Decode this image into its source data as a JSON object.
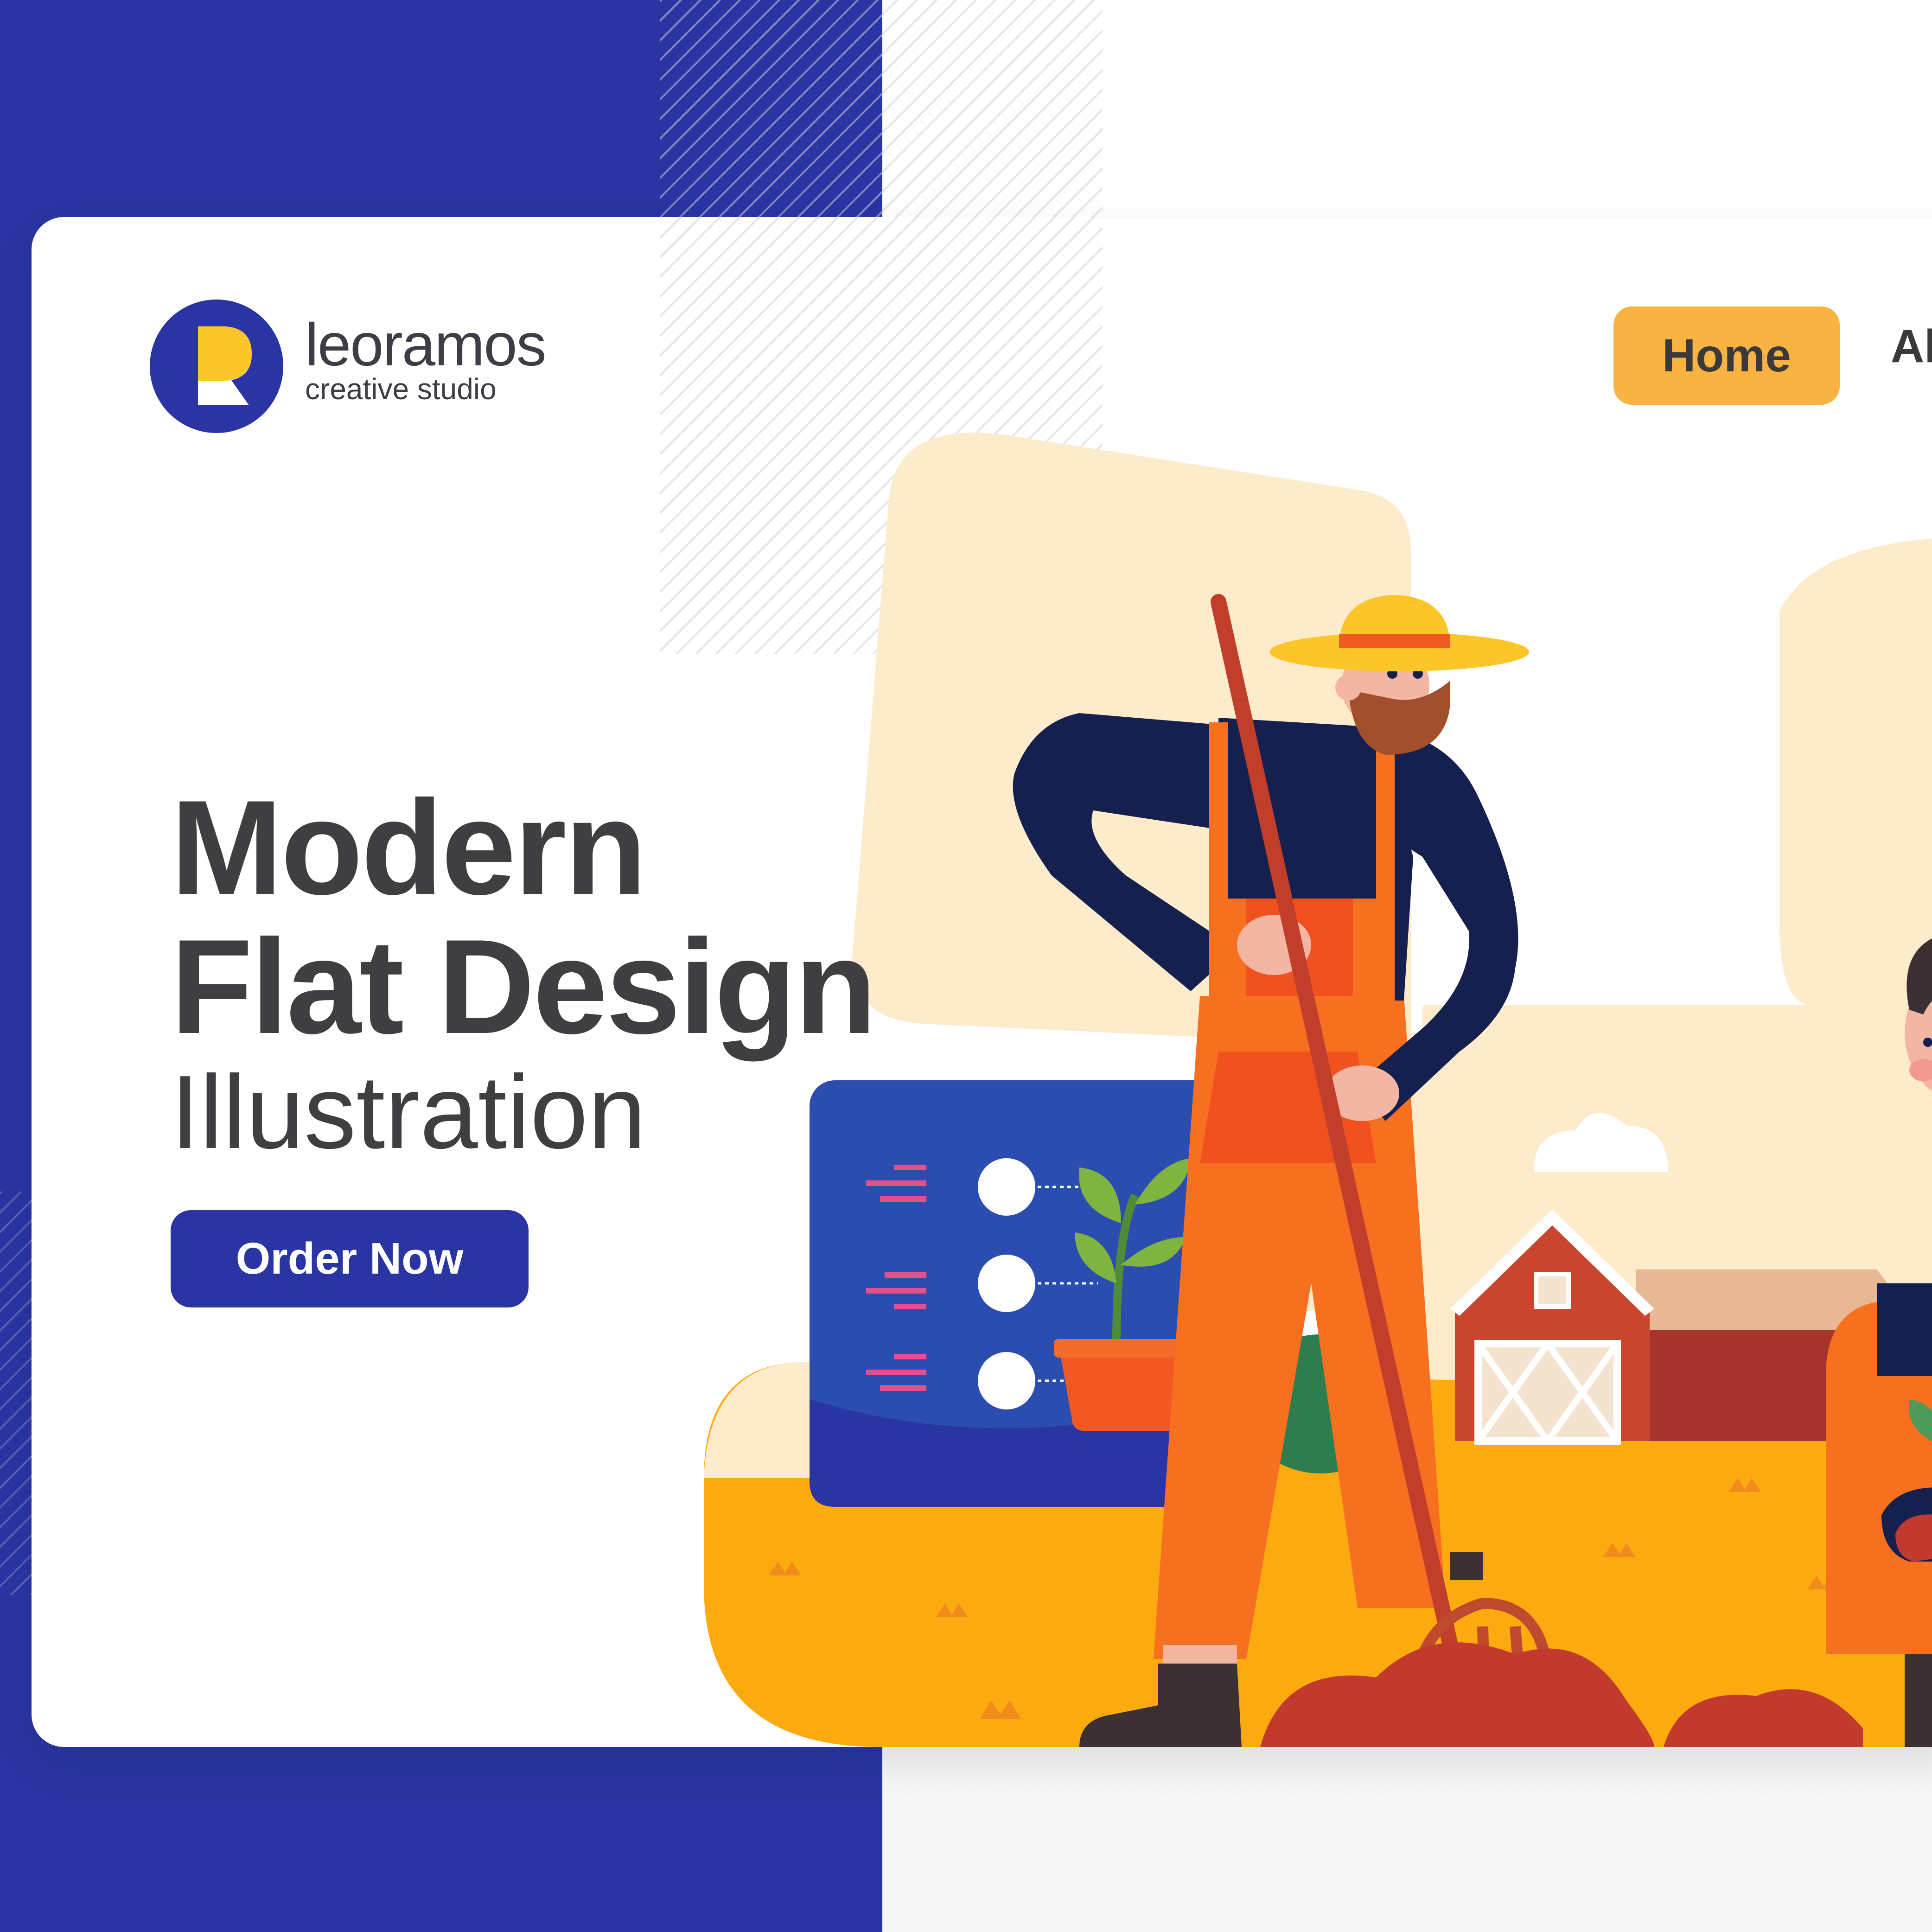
{
  "colors": {
    "brand_blue": "#2a35a3",
    "accent_orange": "#f9b342",
    "text_dark": "#3f3f42",
    "field_yellow": "#fbab0f",
    "pale_yellow": "#fdeccb",
    "overalls_orange": "#f7701f",
    "barn_red": "#c9452e"
  },
  "logo": {
    "mark_icon": "letter-r-logo-icon",
    "name": "leoramos",
    "tagline": "creative studio"
  },
  "nav": {
    "items": [
      {
        "label": "Home",
        "active": true
      },
      {
        "label": "Al",
        "active": false
      }
    ]
  },
  "hero": {
    "line1": "Modern",
    "line2": "Flat Design",
    "line3": "Illustration",
    "cta_label": "Order Now"
  },
  "illustration": {
    "checklist_icon": "checklist-card-icon",
    "plant_icon": "potted-plant-icon",
    "farmer_icon": "farmer-with-pitchfork-icon",
    "barn_icon": "barn-icon",
    "cloud_icon": "cloud-icon",
    "second_farmer_icon": "farmer-holding-plant-icon"
  }
}
